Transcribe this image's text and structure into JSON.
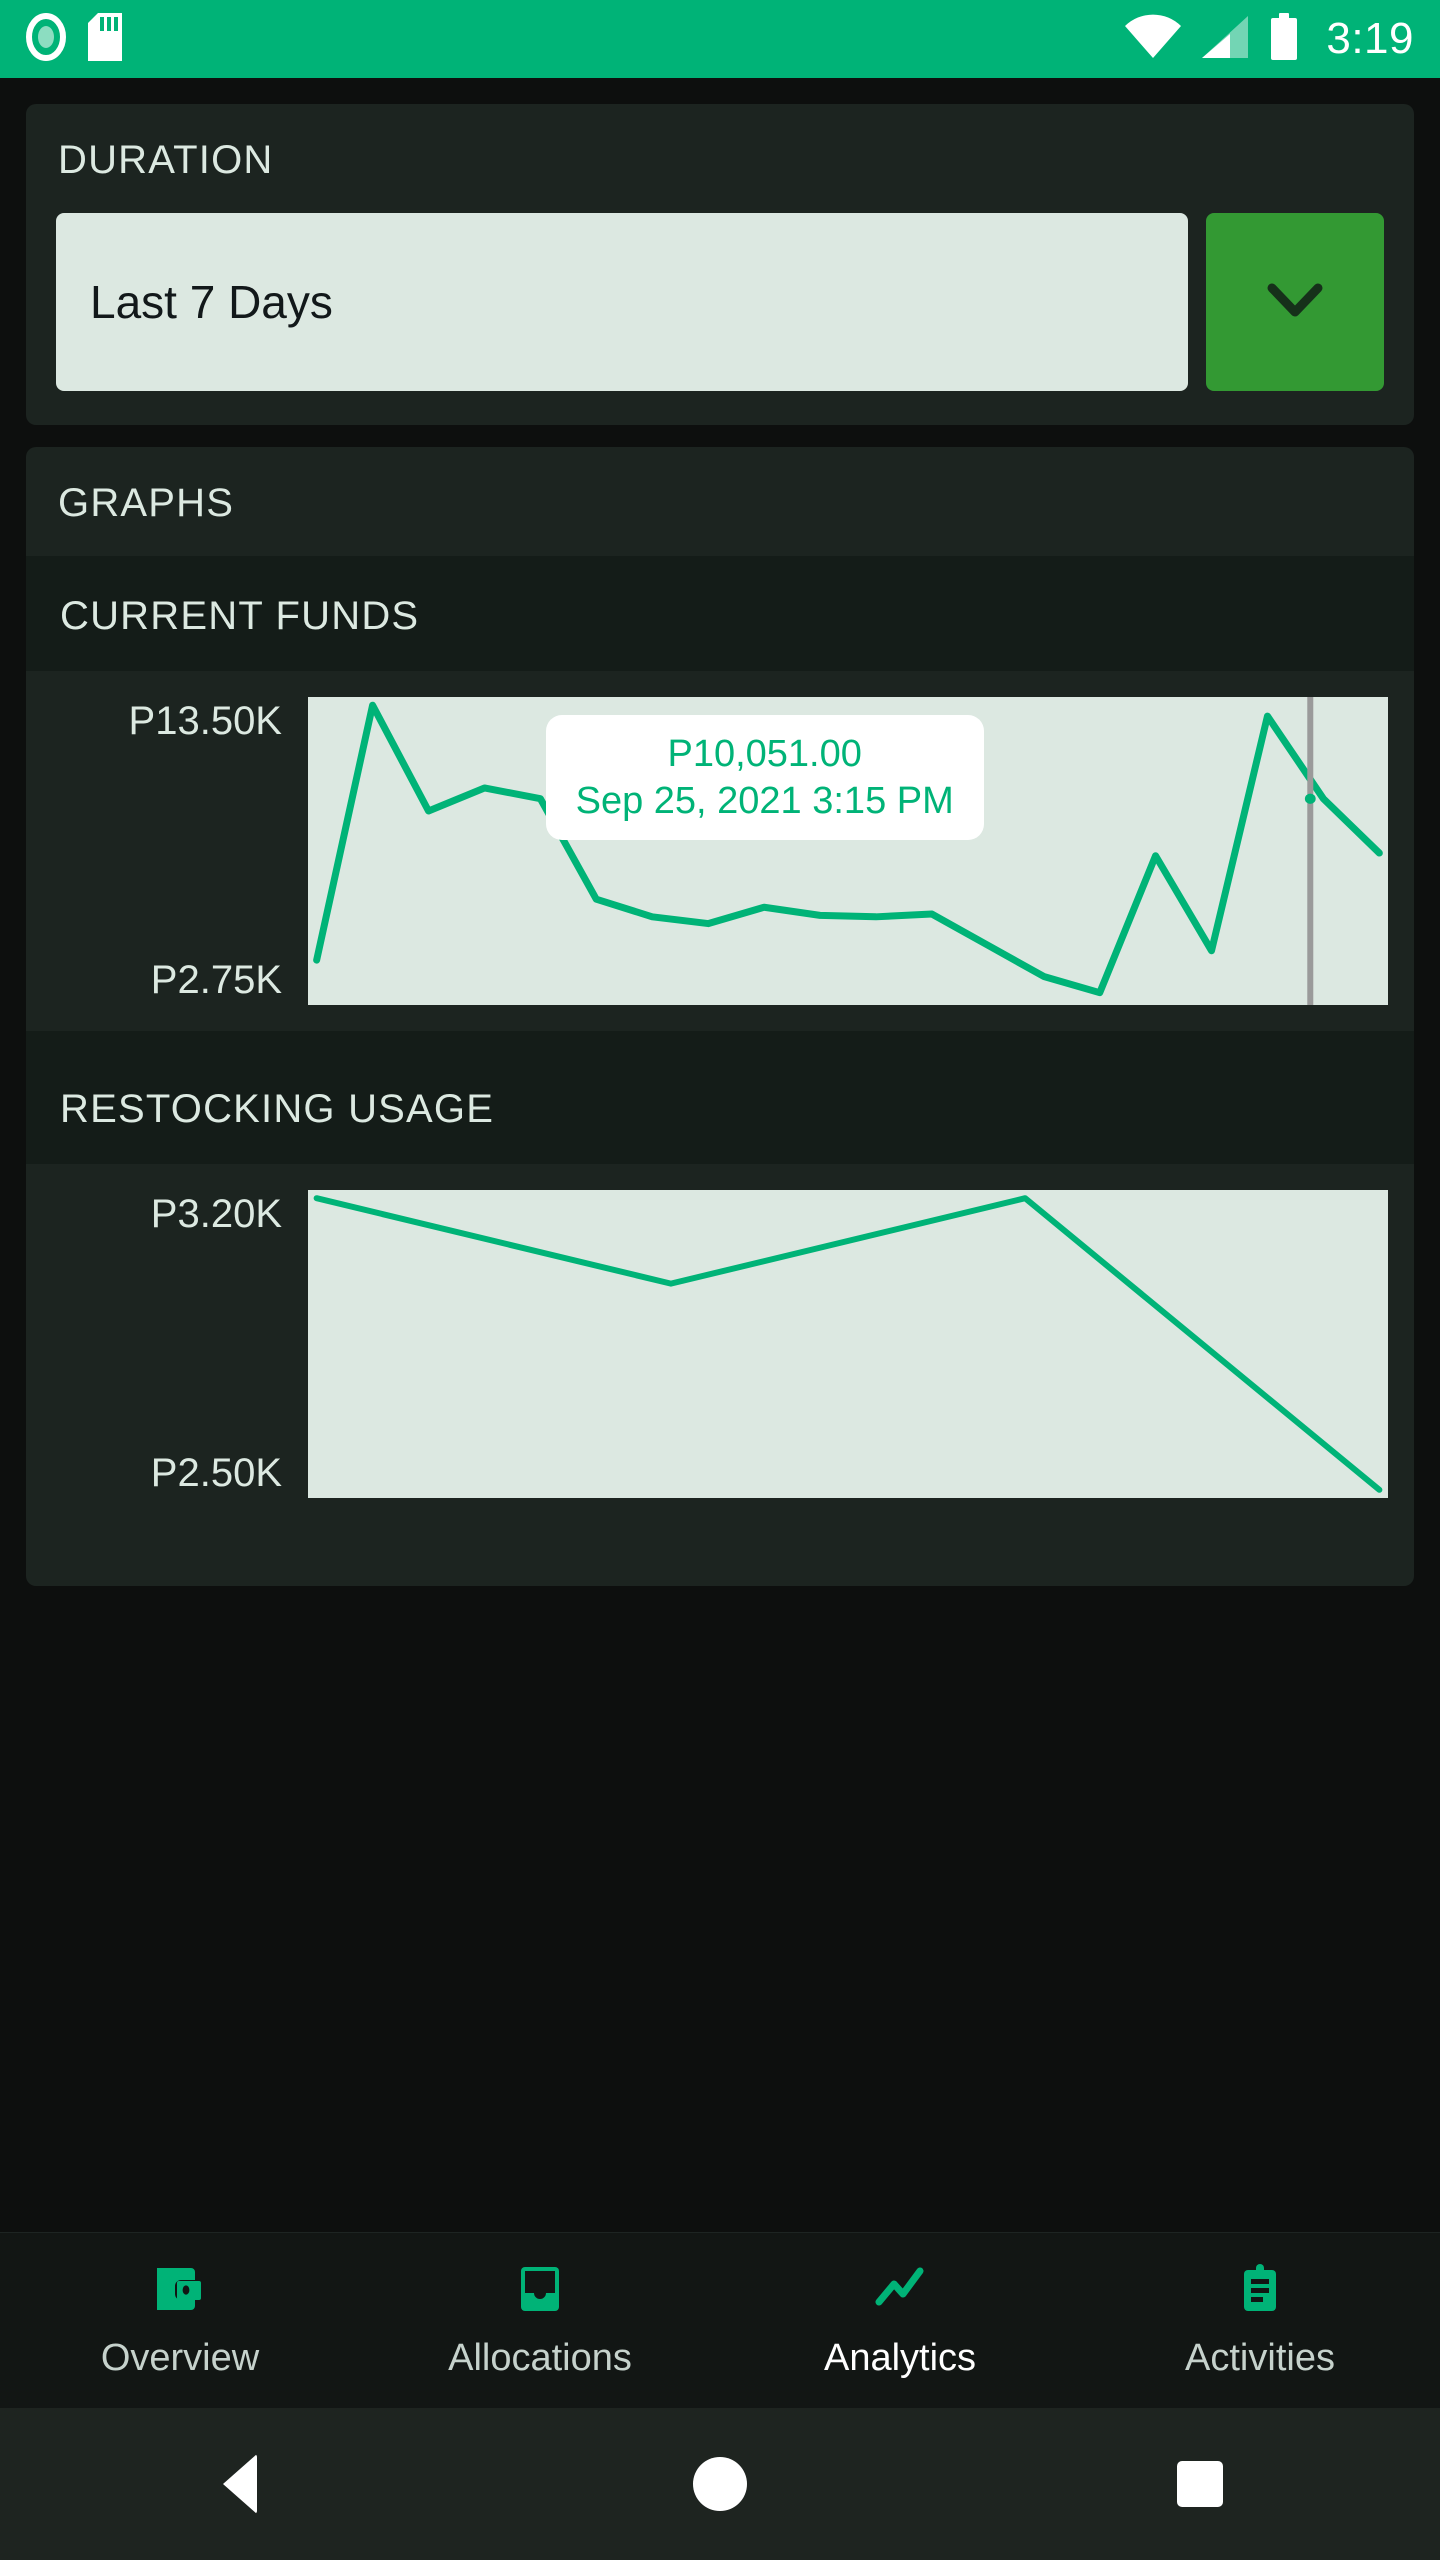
{
  "status_bar": {
    "icons": [
      "record-icon",
      "sd-card-icon",
      "wifi-icon",
      "signal-icon",
      "battery-icon"
    ],
    "time": "3:19",
    "background": "#00b377"
  },
  "duration_card": {
    "title": "DURATION",
    "selected_value": "Last 7 Days",
    "dropdown_icon": "chevron-down-icon",
    "dropdown_button_color": "#339933"
  },
  "graphs_card": {
    "title": "GRAPHS"
  },
  "charts": [
    {
      "title": "CURRENT FUNDS",
      "y_top_label": "P13.50K",
      "y_bottom_label": "P2.75K",
      "tooltip": {
        "amount": "P10,051.00",
        "timestamp": "Sep 25, 2021 3:15 PM"
      }
    },
    {
      "title": "RESTOCKING USAGE",
      "y_top_label": "P3.20K",
      "y_bottom_label": "P2.50K"
    }
  ],
  "chart_data": [
    {
      "type": "line",
      "title": "CURRENT FUNDS",
      "ylabel": "",
      "xlabel": "",
      "ylim": [
        2750,
        13500
      ],
      "ytick_labels": [
        "P2.75K",
        "P13.50K"
      ],
      "grid": false,
      "legend": "none",
      "fill": true,
      "line_color": "#00b377",
      "fill_color": "#dce8e1",
      "annotation": {
        "label": "P10,051.00\nSep 25, 2021 3:15 PM",
        "marker_x_fraction": 0.935,
        "marker_value": 10051
      },
      "x": [
        0,
        1,
        2,
        3,
        4,
        5,
        6,
        7,
        8,
        9,
        10,
        11,
        12,
        13,
        14,
        15,
        16,
        17,
        18,
        19
      ],
      "values": [
        4100,
        13500,
        9600,
        10450,
        10050,
        6350,
        5700,
        5450,
        6050,
        5750,
        5700,
        5800,
        4650,
        3500,
        2900,
        7950,
        4450,
        13100,
        10051,
        8050
      ]
    },
    {
      "type": "line",
      "title": "RESTOCKING USAGE",
      "ylabel": "",
      "xlabel": "",
      "ylim": [
        2500,
        3200
      ],
      "ytick_labels": [
        "P2.50K",
        "P3.20K"
      ],
      "grid": false,
      "legend": "none",
      "fill": true,
      "line_color": "#00b377",
      "fill_color": "#dce8e1",
      "x": [
        0,
        1,
        2,
        3
      ],
      "values": [
        3200,
        2995,
        3200,
        2500
      ]
    }
  ],
  "bottom_nav": {
    "items": [
      {
        "label": "Overview",
        "icon": "wallet-icon",
        "active": false
      },
      {
        "label": "Allocations",
        "icon": "inbox-icon",
        "active": false
      },
      {
        "label": "Analytics",
        "icon": "trending-up-icon",
        "active": true
      },
      {
        "label": "Activities",
        "icon": "clipboard-icon",
        "active": false
      }
    ],
    "accent_color": "#00b377"
  },
  "system_nav": {
    "back": "back-triangle-icon",
    "home": "home-circle-icon",
    "recents": "recents-square-icon"
  }
}
